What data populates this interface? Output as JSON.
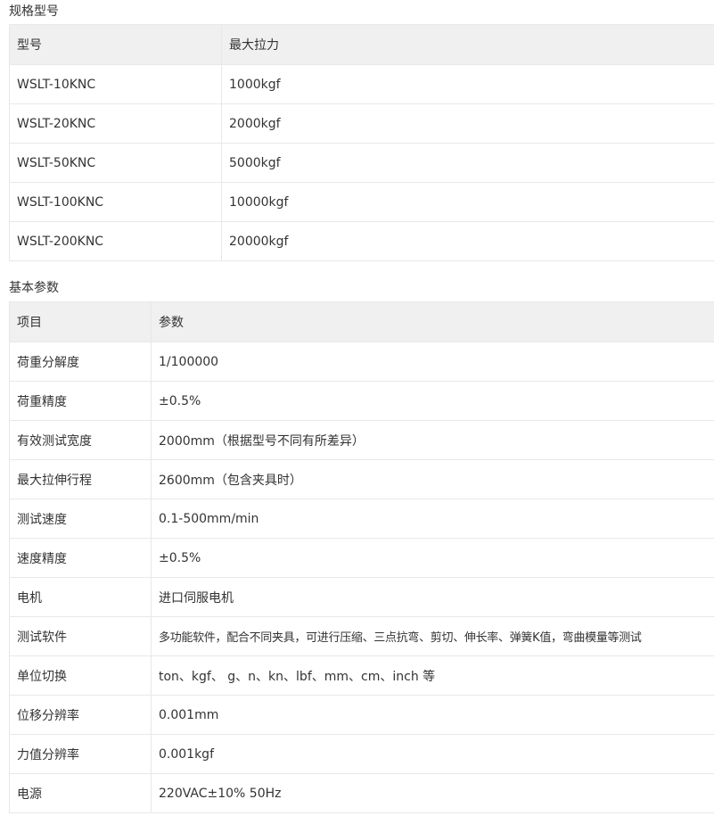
{
  "spec_section": {
    "title": "规格型号",
    "headers": [
      "型号",
      "最大拉力"
    ],
    "rows": [
      [
        "WSLT-10KNC",
        "1000kgf"
      ],
      [
        "WSLT-20KNC",
        "2000kgf"
      ],
      [
        "WSLT-50KNC",
        "5000kgf"
      ],
      [
        "WSLT-100KNC",
        "10000kgf"
      ],
      [
        "WSLT-200KNC",
        "20000kgf"
      ]
    ]
  },
  "param_section": {
    "title": "基本参数",
    "headers": [
      "项目",
      "参数"
    ],
    "rows": [
      [
        "荷重分解度",
        "1/100000"
      ],
      [
        "荷重精度",
        "±0.5%"
      ],
      [
        "有效测试宽度",
        "2000mm（根据型号不同有所差异）"
      ],
      [
        "最大拉伸行程",
        "2600mm（包含夹具时）"
      ],
      [
        "测试速度",
        "0.1-500mm/min"
      ],
      [
        "速度精度",
        "±0.5%"
      ],
      [
        "电机",
        "进口伺服电机"
      ],
      [
        "测试软件",
        "多功能软件，配合不同夹具，可进行压缩、三点抗弯、剪切、伸长率、弹簧K值，弯曲模量等测试"
      ],
      [
        "单位切换",
        "ton、kgf、 g、n、kn、lbf、mm、cm、inch 等"
      ],
      [
        "位移分辨率",
        "0.001mm"
      ],
      [
        "力值分辨率",
        "0.001kgf"
      ],
      [
        "电源",
        "220VAC±10% 50Hz"
      ]
    ]
  }
}
